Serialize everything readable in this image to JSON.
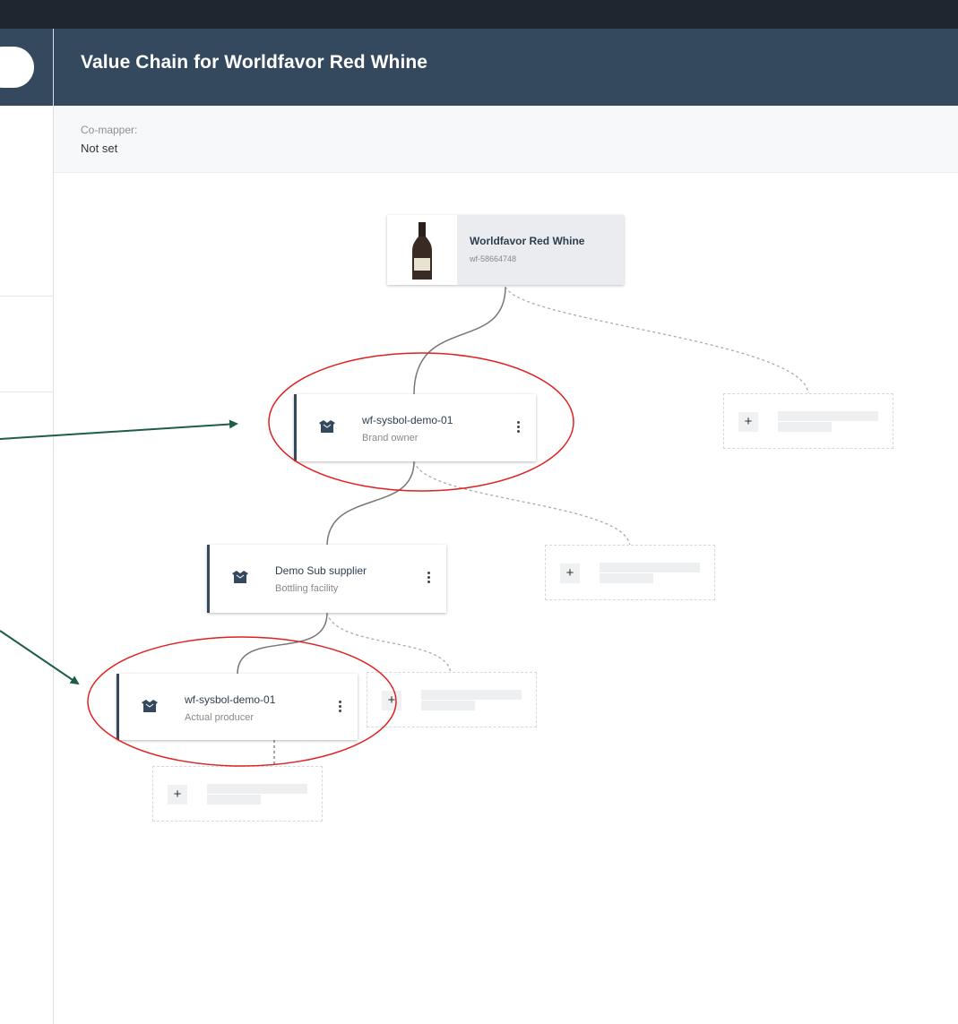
{
  "header": {
    "title": "Value Chain for Worldfavor Red Whine"
  },
  "info": {
    "co_mapper_label": "Co-mapper:",
    "co_mapper_value": "Not set"
  },
  "product": {
    "name": "Worldfavor Red Whine",
    "id": "wf-58664748",
    "icon": "wine-bottle-icon"
  },
  "nodes": [
    {
      "name": "wf-sysbol-demo-01",
      "role": "Brand owner",
      "icon": "box-icon"
    },
    {
      "name": "Demo Sub supplier",
      "role": "Bottling facility",
      "icon": "box-icon"
    },
    {
      "name": "wf-sysbol-demo-01",
      "role": "Actual producer",
      "icon": "box-icon"
    }
  ],
  "placeholders": {
    "add_symbol": "+"
  },
  "colors": {
    "topbar": "#1e2730",
    "header": "#34495e",
    "node_accent": "#34495e",
    "highlight_ellipse": "#e02020",
    "annotation_arrow": "#1e5e47"
  }
}
